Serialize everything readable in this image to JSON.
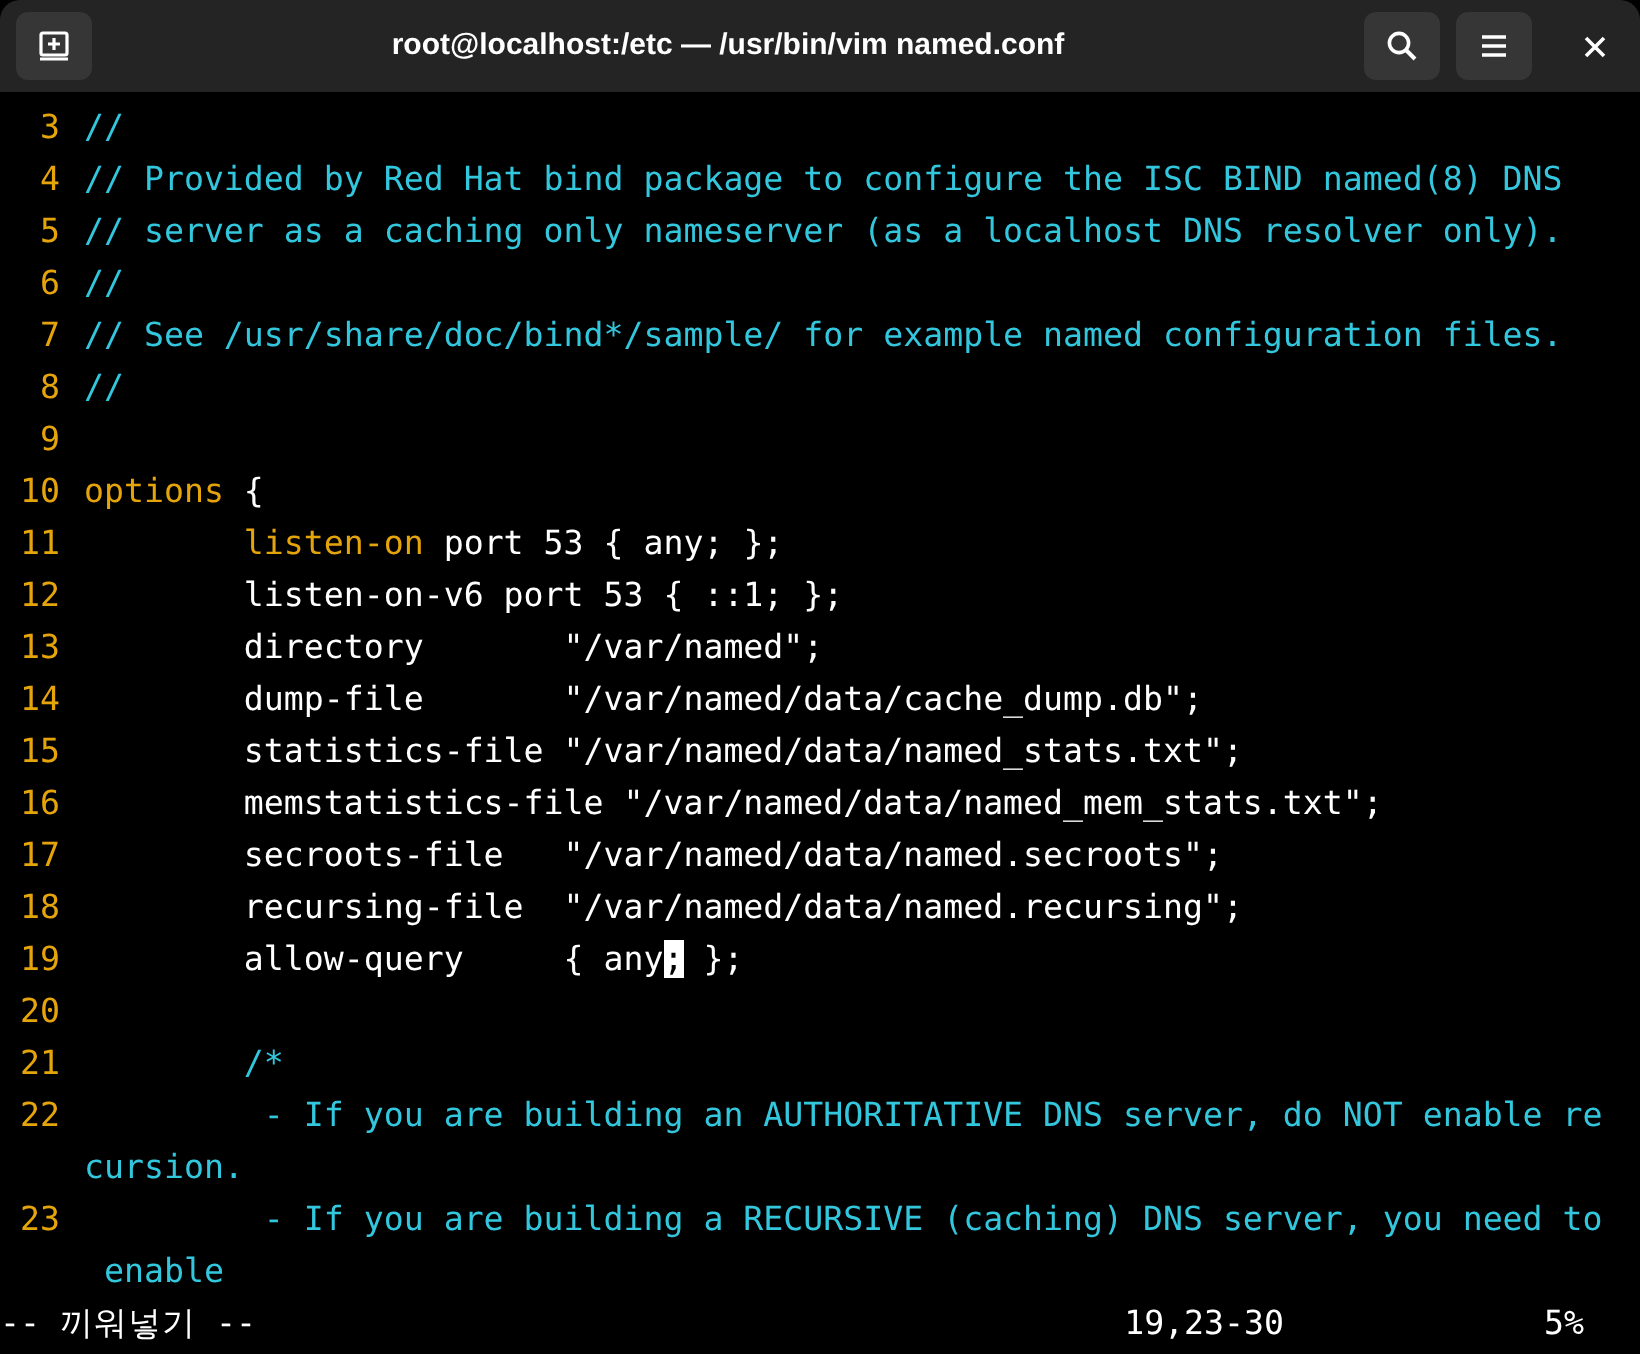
{
  "window": {
    "title": "root@localhost:/etc — /usr/bin/vim named.conf"
  },
  "editor": {
    "lines": [
      {
        "number": "3",
        "segments": [
          {
            "kind": "comment",
            "text": "//"
          }
        ]
      },
      {
        "number": "4",
        "segments": [
          {
            "kind": "comment",
            "text": "// Provided by Red Hat bind package to configure the ISC BIND named(8) DNS"
          }
        ]
      },
      {
        "number": "5",
        "segments": [
          {
            "kind": "comment",
            "text": "// server as a caching only nameserver (as a localhost DNS resolver only)."
          }
        ]
      },
      {
        "number": "6",
        "segments": [
          {
            "kind": "comment",
            "text": "//"
          }
        ]
      },
      {
        "number": "7",
        "segments": [
          {
            "kind": "comment",
            "text": "// See /usr/share/doc/bind*/sample/ for example named configuration files."
          }
        ]
      },
      {
        "number": "8",
        "segments": [
          {
            "kind": "comment",
            "text": "//"
          }
        ]
      },
      {
        "number": "9"
      },
      {
        "number": "10",
        "segments": [
          {
            "kind": "keyword",
            "text": "options"
          },
          {
            "kind": "plain",
            "text": " {"
          }
        ]
      },
      {
        "number": "11",
        "segments": [
          {
            "kind": "keyword",
            "text": "        listen-on"
          },
          {
            "kind": "plain",
            "text": " port 53 { any; };"
          }
        ]
      },
      {
        "number": "12",
        "segments": [
          {
            "kind": "plain",
            "text": "        listen-on-v6 port 53 { ::1; };"
          }
        ]
      },
      {
        "number": "13",
        "segments": [
          {
            "kind": "plain",
            "text": "        directory       \"/var/named\";"
          }
        ]
      },
      {
        "number": "14",
        "segments": [
          {
            "kind": "plain",
            "text": "        dump-file       \"/var/named/data/cache_dump.db\";"
          }
        ]
      },
      {
        "number": "15",
        "segments": [
          {
            "kind": "plain",
            "text": "        statistics-file \"/var/named/data/named_stats.txt\";"
          }
        ]
      },
      {
        "number": "16",
        "segments": [
          {
            "kind": "plain",
            "text": "        memstatistics-file \"/var/named/data/named_mem_stats.txt\";"
          }
        ]
      },
      {
        "number": "17",
        "segments": [
          {
            "kind": "plain",
            "text": "        secroots-file   \"/var/named/data/named.secroots\";"
          }
        ]
      },
      {
        "number": "18",
        "segments": [
          {
            "kind": "plain",
            "text": "        recursing-file  \"/var/named/data/named.recursing\";"
          }
        ]
      },
      {
        "number": "19",
        "segments": [
          {
            "kind": "plain",
            "text": "        allow-query     { any"
          },
          {
            "kind": "cursor",
            "text": ";"
          },
          {
            "kind": "plain",
            "text": " };"
          }
        ]
      },
      {
        "number": "20"
      },
      {
        "number": "21",
        "segments": [
          {
            "kind": "comment",
            "text": "        /*"
          }
        ]
      },
      {
        "number": "22",
        "segments": [
          {
            "kind": "comment",
            "text": "         - If you are building an AUTHORITATIVE DNS server, do NOT enable re"
          }
        ],
        "wrapped": [
          {
            "kind": "comment",
            "text": "cursion."
          }
        ]
      },
      {
        "number": "23",
        "segments": [
          {
            "kind": "comment",
            "text": "         - If you are building a RECURSIVE (caching) DNS server, you need to"
          }
        ],
        "wrapped": [
          {
            "kind": "comment",
            "text": " enable"
          }
        ]
      }
    ]
  },
  "status_bar": {
    "mode": "-- 끼워넣기 --",
    "position": "19,23-30",
    "scroll": "5%"
  }
}
